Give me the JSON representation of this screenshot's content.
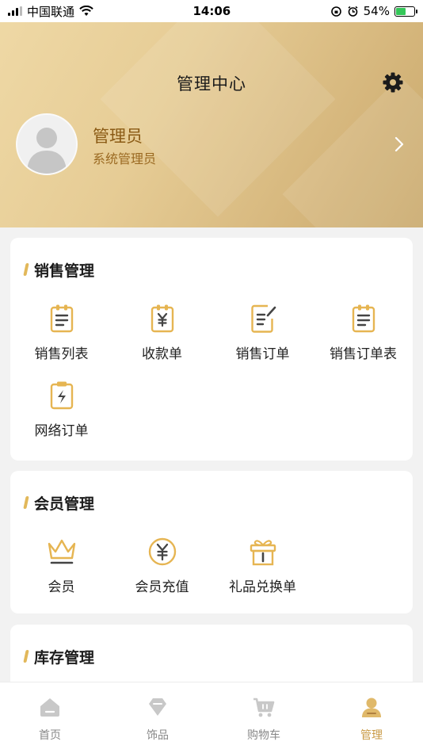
{
  "status_bar": {
    "carrier": "中国联通",
    "time": "14:06",
    "battery_percent": "54%",
    "battery_level": 0.54
  },
  "header": {
    "title": "管理中心",
    "settings_icon": "gear-icon"
  },
  "profile": {
    "name": "管理员",
    "role": "系统管理员"
  },
  "sections": {
    "sales": {
      "title": "销售管理",
      "items": [
        {
          "label": "销售列表",
          "icon": "clipboard-list-icon"
        },
        {
          "label": "收款单",
          "icon": "clipboard-yen-icon"
        },
        {
          "label": "销售订单",
          "icon": "document-edit-icon"
        },
        {
          "label": "销售订单表",
          "icon": "clipboard-list-icon"
        },
        {
          "label": "网络订单",
          "icon": "clipboard-bolt-icon"
        }
      ]
    },
    "member": {
      "title": "会员管理",
      "items": [
        {
          "label": "会员",
          "icon": "crown-icon"
        },
        {
          "label": "会员充值",
          "icon": "yen-coin-icon"
        },
        {
          "label": "礼品兑换单",
          "icon": "gift-icon"
        }
      ]
    },
    "inventory": {
      "title": "库存管理"
    }
  },
  "tabbar": {
    "items": [
      {
        "label": "首页",
        "icon": "home-icon",
        "active": false
      },
      {
        "label": "饰品",
        "icon": "gem-icon",
        "active": false
      },
      {
        "label": "购物车",
        "icon": "cart-icon",
        "active": false
      },
      {
        "label": "管理",
        "icon": "user-icon",
        "active": true
      }
    ]
  },
  "colors": {
    "accent": "#e2b85a",
    "gold_header": "#d6b77d",
    "name_color": "#8a5a14",
    "active_tab": "#c99a45"
  }
}
